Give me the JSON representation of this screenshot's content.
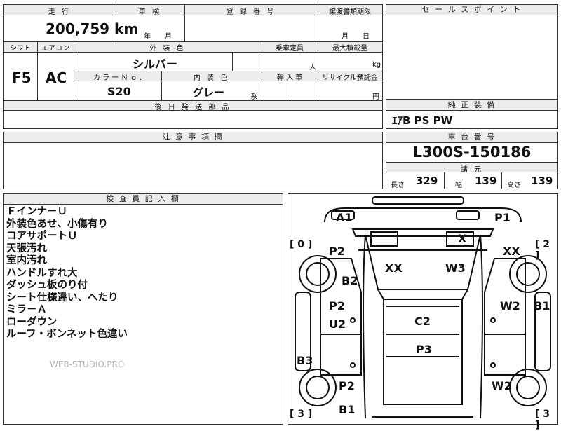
{
  "top": {
    "mileage_header": "走 行",
    "mileage": "200,759 km",
    "inspection_header": "車 検",
    "inspection_units": "年　　月",
    "reg_header": "登 録 番 号",
    "transfer_header": "譲渡書類期限",
    "transfer_units": "月　　日",
    "shift_header": "シフト",
    "shift": "F5",
    "ac_header": "エアコン",
    "ac": "AC",
    "exterior_header": "外 装 色",
    "exterior_color": "シルバー",
    "capacity_header": "乗車定員",
    "capacity_unit": "人",
    "load_header": "最大積載量",
    "load_unit": "kg",
    "color_no_header": "カ ラ ー Ｎ ｏ .",
    "color_no": "S20",
    "interior_header": "内 装 色",
    "interior_color": "グレー",
    "interior_suffix": "系",
    "import_header": "輸 入 車",
    "recycle_header": "リサイクル預託金",
    "recycle_unit": "円",
    "later_parts_header": "後 日 発 送 部 品"
  },
  "sales": {
    "header": "セ ー ル ス ポ イ ン ト"
  },
  "equipment": {
    "header": "純 正 装 備",
    "value": "ｴｱB PS PW"
  },
  "caution": {
    "header": "注 意 事 項 欄"
  },
  "chassis": {
    "header": "車 台 番 号",
    "number": "L300S-150186",
    "dims_header": "諸 元",
    "length_label": "長さ",
    "length": "329",
    "width_label": "幅",
    "width": "139",
    "height_label": "高さ",
    "height": "139"
  },
  "inspector": {
    "header": "検 査 員 記 入 欄",
    "notes": [
      "Ｆインナ－Ｕ",
      "外装色あせ、小傷有り",
      "コアサポートＵ",
      "天張汚れ",
      "室内汚れ",
      "ハンドルすれ大",
      "ダッシュ板のり付",
      "シート仕様違い、へたり",
      "ミラ－Ａ",
      "ローダウン",
      "ルーフ・ボンネット色違い"
    ],
    "watermark": "WEB-STUDIO.PRO"
  },
  "diagram": {
    "tire_fl": "[ 0 ]",
    "tire_fr": "[ 2 ]",
    "tire_rl": "[ 3 ]",
    "tire_rr": "[ 3 ]",
    "marks": {
      "a1": "A1",
      "p1": "P1",
      "x": "X",
      "p2_fl": "P2",
      "xx_fr": "XX",
      "xx_c": "XX",
      "w3": "W3",
      "b2": "B2",
      "p2_dl": "P2",
      "w2_dr": "W2",
      "b1_r": "B1",
      "u2": "U2",
      "c2": "C2",
      "p3": "P3",
      "b3": "B3",
      "p2_rl": "P2",
      "w2_rr": "W2",
      "b1_b": "B1"
    }
  }
}
